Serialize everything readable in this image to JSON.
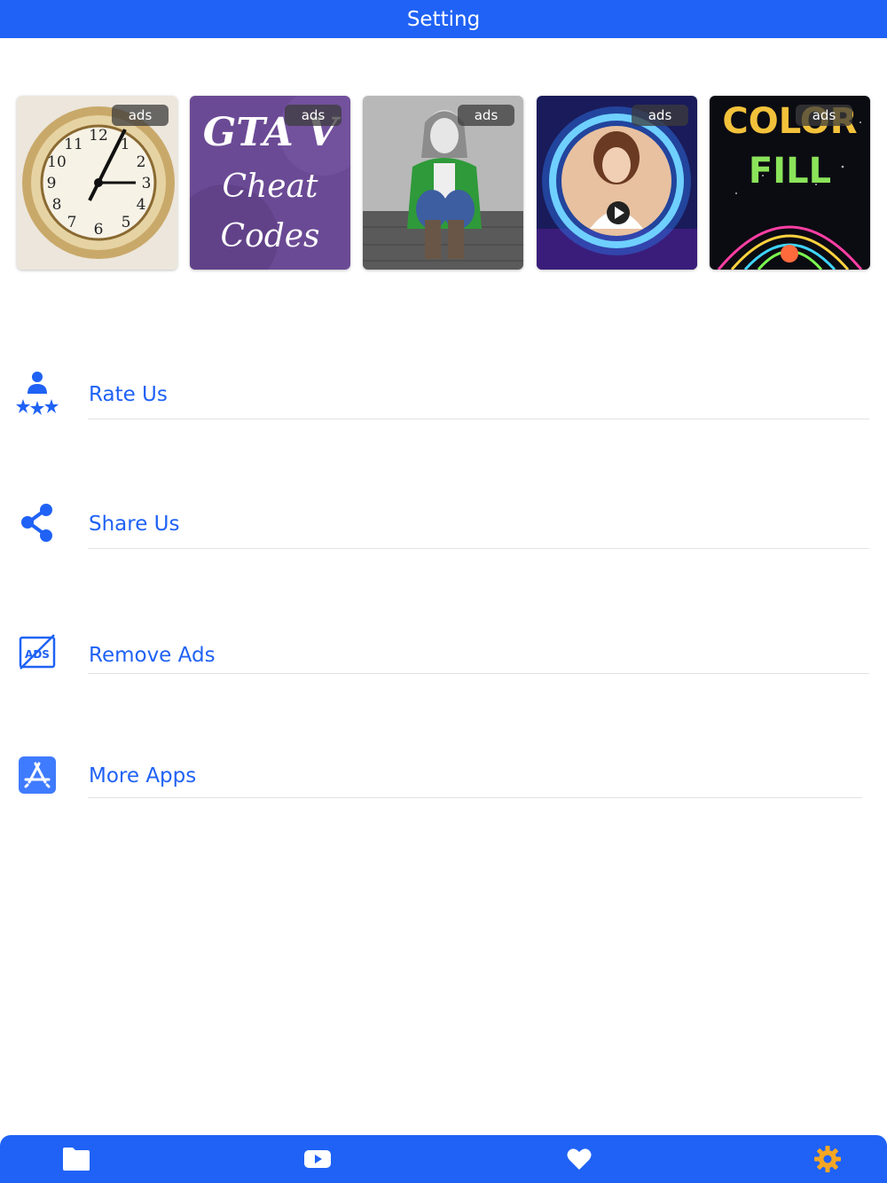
{
  "header": {
    "title": "Setting"
  },
  "ads": {
    "badge": "ads",
    "tiles": [
      {
        "name": "clock-app-ad"
      },
      {
        "name": "gta-cheat-codes-ad",
        "lines": [
          "GTA V",
          "Cheat",
          "Codes"
        ]
      },
      {
        "name": "color-splash-photo-ad"
      },
      {
        "name": "photo-frame-video-ad"
      },
      {
        "name": "color-fill-ad",
        "lines": [
          "COLOR",
          "FILL"
        ]
      }
    ]
  },
  "menu": {
    "items": [
      {
        "label": "Rate Us",
        "icon": "rate-us-icon"
      },
      {
        "label": "Share Us",
        "icon": "share-icon"
      },
      {
        "label": "Remove Ads",
        "icon": "remove-ads-icon",
        "icon_text": "ADS"
      },
      {
        "label": "More Apps",
        "icon": "app-store-icon"
      }
    ]
  },
  "tabbar": {
    "tabs": [
      {
        "icon": "folder-icon"
      },
      {
        "icon": "video-play-icon"
      },
      {
        "icon": "heart-icon"
      },
      {
        "icon": "gear-icon",
        "active": true
      }
    ]
  },
  "colors": {
    "accent": "#1f62f5",
    "active_tab": "#f5a623",
    "divider": "#e2e2e2"
  }
}
